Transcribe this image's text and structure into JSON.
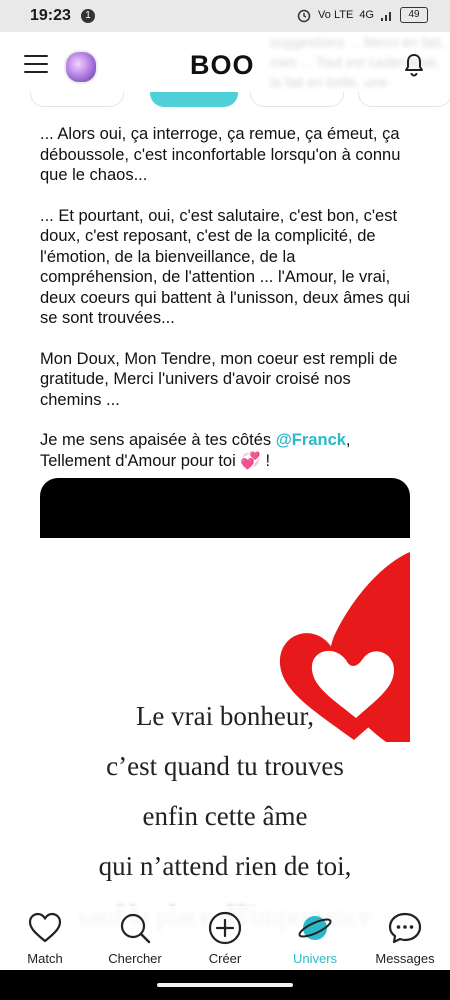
{
  "status": {
    "time": "19:23",
    "notification_count": "1",
    "network": "4G",
    "battery": "49"
  },
  "header": {
    "title": "BOO",
    "ghost_text": "suggestions ... Merci en fait, mes ... Tout est cadenassé, la fait en belle, une éclaboussure d'Amour de son Amour ... auraient jamais eu un sujet"
  },
  "post": {
    "paragraphs": [
      "... Alors oui, ça interroge, ça remue, ça émeut, ça déboussole, c'est inconfortable lorsqu'on à connu que le chaos...",
      "... Et pourtant, oui, c'est salutaire, c'est bon, c'est doux, c'est reposant, c'est de la complicité, de l'émotion, de la bienveillance, de la compréhension, de l'attention ... l'Amour, le vrai, deux coeurs qui battent à l'unisson, deux âmes qui se sont trouvées...",
      "Mon Doux, Mon Tendre, mon coeur est rempli de gratitude, Merci l'univers d'avoir croisé nos chemins ..."
    ],
    "last_prefix": "Je me sens apaisée à tes côtés ",
    "mention": "@Franck",
    "last_suffix": ",",
    "last_line2": "Tellement d'Amour pour toi 💞 !"
  },
  "image_card": {
    "quote_lines": [
      "Le vrai bonheur,",
      "c’est quand tu trouves",
      "enfin cette âme",
      "qui n’attend rien de toi,",
      "sauf la place d'l'importance"
    ]
  },
  "tabs": [
    {
      "label": "Match",
      "icon": "heart-icon"
    },
    {
      "label": "Chercher",
      "icon": "search-icon"
    },
    {
      "label": "Créer",
      "icon": "plus-circle-icon"
    },
    {
      "label": "Univers",
      "icon": "planet-icon"
    },
    {
      "label": "Messages",
      "icon": "chat-bubble-icon"
    }
  ],
  "colors": {
    "accent": "#2bb9c9",
    "heart": "#e8191b"
  }
}
